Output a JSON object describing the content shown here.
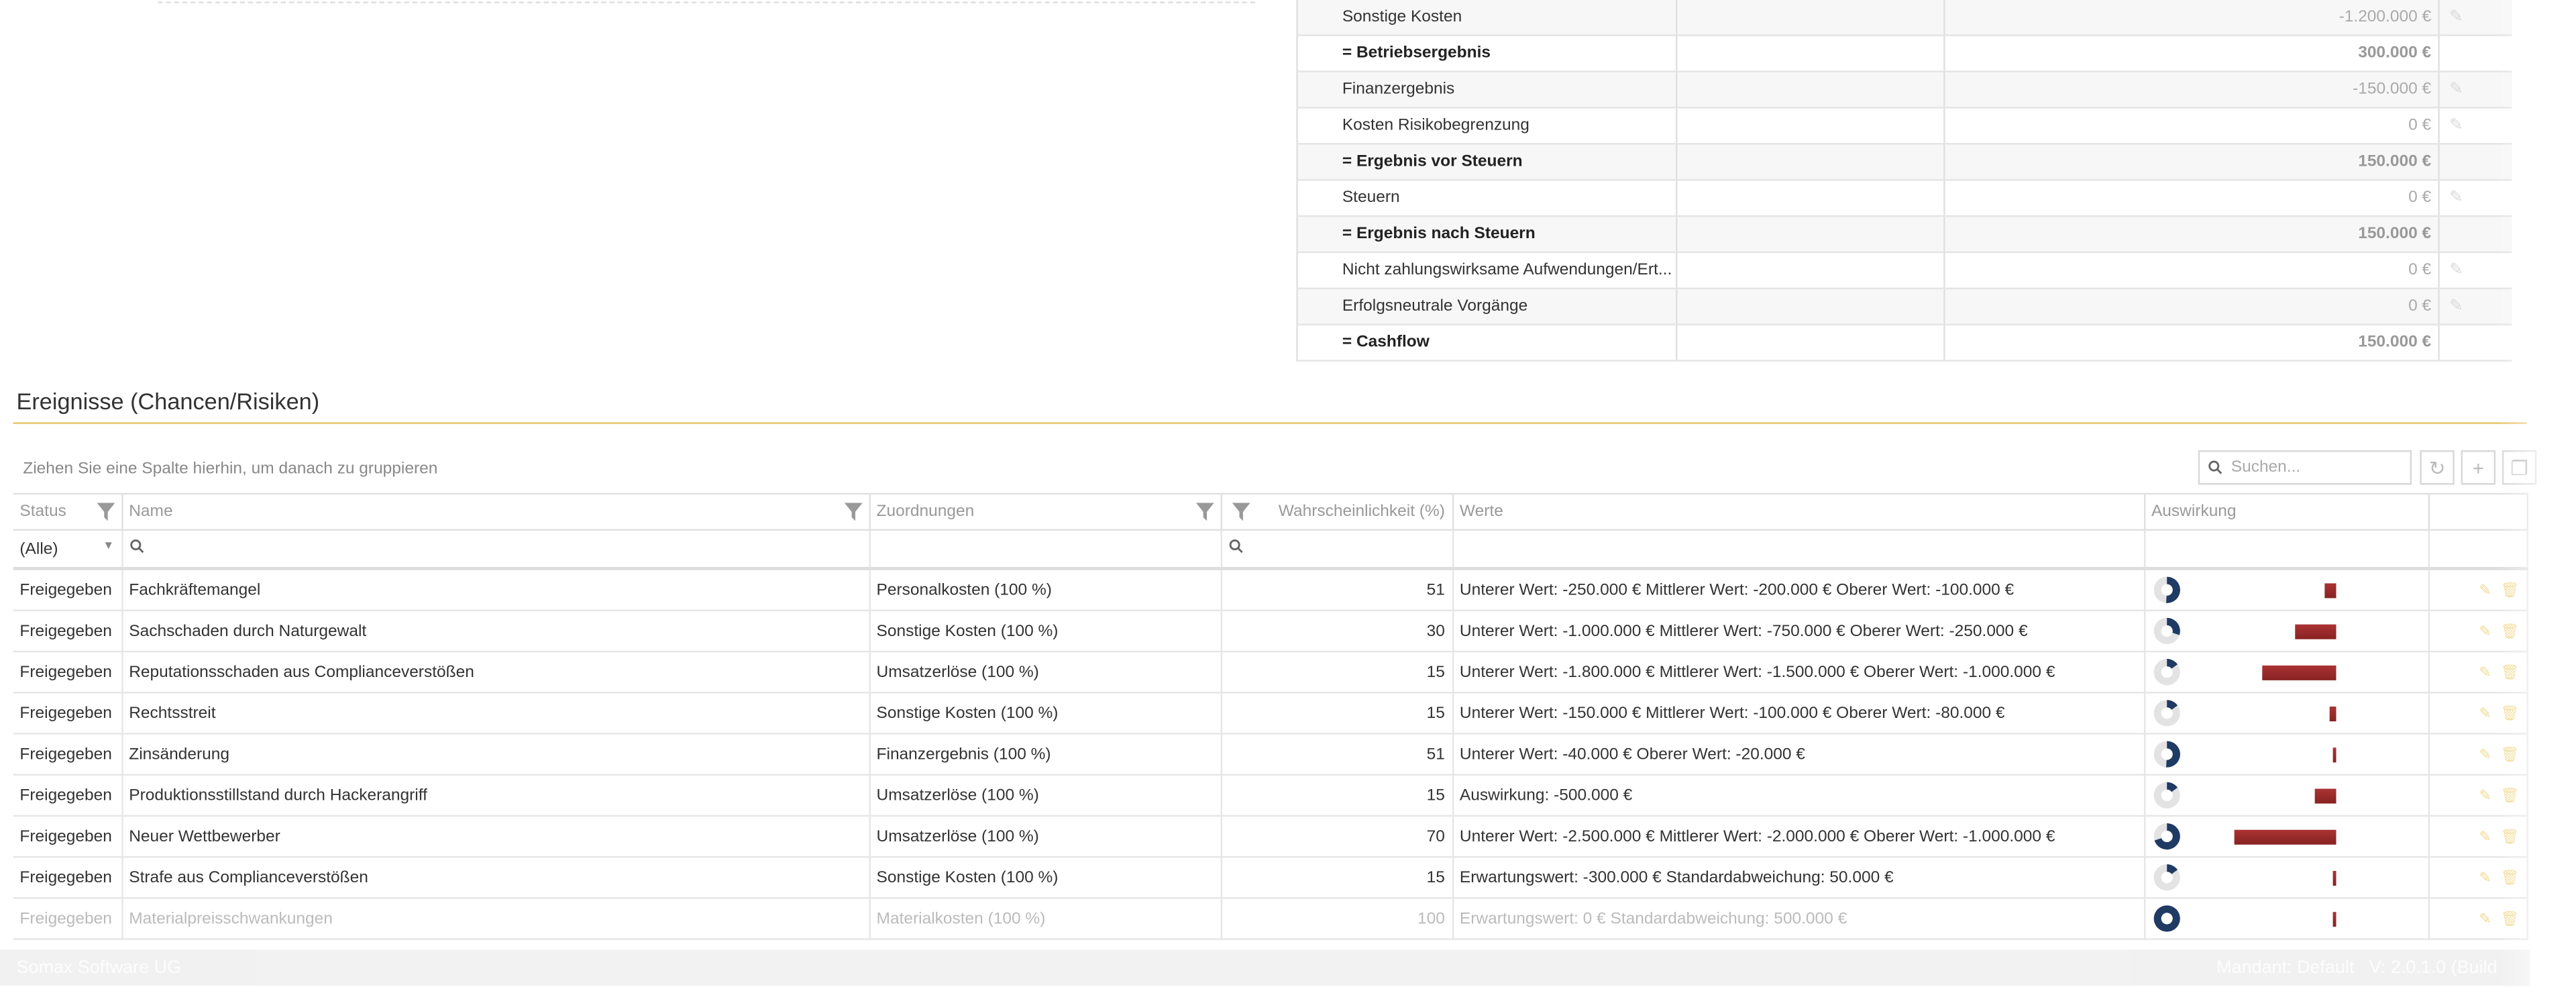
{
  "pnl_rows": [
    {
      "label": "Sonstige Kosten",
      "value": "-1.200.000 €",
      "sum": false
    },
    {
      "label": "= Betriebsergebnis",
      "value": "300.000 €",
      "sum": true
    },
    {
      "label": "Finanzergebnis",
      "value": "-150.000 €",
      "sum": false
    },
    {
      "label": "Kosten Risikobegrenzung",
      "value": "0 €",
      "sum": false
    },
    {
      "label": "= Ergebnis vor Steuern",
      "value": "150.000 €",
      "sum": true
    },
    {
      "label": "Steuern",
      "value": "0 €",
      "sum": false
    },
    {
      "label": "= Ergebnis nach Steuern",
      "value": "150.000 €",
      "sum": true
    },
    {
      "label": "Nicht zahlungswirksame Aufwendungen/Ert...",
      "value": "0 €",
      "sum": false
    },
    {
      "label": "Erfolgsneutrale Vorgänge",
      "value": "0 €",
      "sum": false
    },
    {
      "label": "= Cashflow",
      "value": "150.000 €",
      "sum": true
    }
  ],
  "section_title": "Ereignisse (Chancen/Risiken)",
  "group_hint": "Ziehen Sie eine Spalte hierhin, um danach zu gruppieren",
  "search_placeholder": "Suchen...",
  "columns": {
    "status": "Status",
    "name": "Name",
    "zuordnungen": "Zuordnungen",
    "wahrscheinlichkeit": "Wahrscheinlichkeit (%)",
    "werte": "Werte",
    "auswirkung": "Auswirkung"
  },
  "filter": {
    "status_value": "(Alle)"
  },
  "rows": [
    {
      "status": "Freigegeben",
      "name": "Fachkräftemangel",
      "zuordnung": "Personalkosten (100 %)",
      "p": "51",
      "werte": "Unterer Wert: -250.000 € Mittlerer Wert: -200.000 € Oberer Wert: -100.000 €",
      "bar": 0.1
    },
    {
      "status": "Freigegeben",
      "name": "Sachschaden durch Naturgewalt",
      "zuordnung": "Sonstige Kosten (100 %)",
      "p": "30",
      "werte": "Unterer Wert: -1.000.000 € Mittlerer Wert: -750.000 € Oberer Wert: -250.000 €",
      "bar": 0.4
    },
    {
      "status": "Freigegeben",
      "name": "Reputationsschaden aus Complianceverstößen",
      "zuordnung": "Umsatzerlöse (100 %)",
      "p": "15",
      "werte": "Unterer Wert: -1.800.000 € Mittlerer Wert: -1.500.000 € Oberer Wert: -1.000.000 €",
      "bar": 0.72
    },
    {
      "status": "Freigegeben",
      "name": "Rechtsstreit",
      "zuordnung": "Sonstige Kosten (100 %)",
      "p": "15",
      "werte": "Unterer Wert: -150.000 € Mittlerer Wert: -100.000 € Oberer Wert: -80.000 €",
      "bar": 0.06
    },
    {
      "status": "Freigegeben",
      "name": "Zinsänderung",
      "zuordnung": "Finanzergebnis (100 %)",
      "p": "51",
      "werte": "Unterer Wert: -40.000 € Oberer Wert: -20.000 €",
      "bar": 0.03
    },
    {
      "status": "Freigegeben",
      "name": "Produktionsstillstand durch Hackerangriff",
      "zuordnung": "Umsatzerlöse (100 %)",
      "p": "15",
      "werte": "Auswirkung: -500.000 €",
      "bar": 0.2
    },
    {
      "status": "Freigegeben",
      "name": "Neuer Wettbewerber",
      "zuordnung": "Umsatzerlöse (100 %)",
      "p": "70",
      "werte": "Unterer Wert: -2.500.000 € Mittlerer Wert: -2.000.000 € Oberer Wert: -1.000.000 €",
      "bar": 1.0
    },
    {
      "status": "Freigegeben",
      "name": "Strafe aus Complianceverstößen",
      "zuordnung": "Sonstige Kosten (100 %)",
      "p": "15",
      "werte": "Erwartungswert: -300.000 € Standardabweichung: 50.000 €",
      "bar": 0.02
    },
    {
      "status": "Freigegeben",
      "name": "Materialpreisschwankungen",
      "zuordnung": "Materialkosten (100 %)",
      "p": "100",
      "werte": "Erwartungswert: 0 € Standardabweichung: 500.000 €",
      "bar": 0.02
    }
  ],
  "footer": {
    "company": "Somax Software UG",
    "mandant": "Mandant: Default",
    "version": "V: 2.0.1.0 (Build"
  },
  "colors": {
    "accent": "#e8c46a",
    "gauge": "#1f3a63",
    "bar": "#9b2c2c"
  }
}
